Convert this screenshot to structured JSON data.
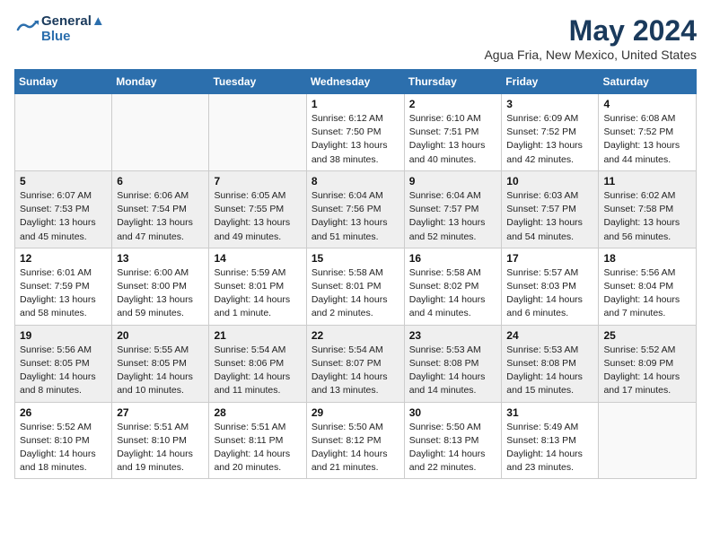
{
  "header": {
    "logo_line1": "General",
    "logo_line2": "Blue",
    "month": "May 2024",
    "location": "Agua Fria, New Mexico, United States"
  },
  "weekdays": [
    "Sunday",
    "Monday",
    "Tuesday",
    "Wednesday",
    "Thursday",
    "Friday",
    "Saturday"
  ],
  "weeks": [
    [
      {
        "day": "",
        "info": ""
      },
      {
        "day": "",
        "info": ""
      },
      {
        "day": "",
        "info": ""
      },
      {
        "day": "1",
        "info": "Sunrise: 6:12 AM\nSunset: 7:50 PM\nDaylight: 13 hours\nand 38 minutes."
      },
      {
        "day": "2",
        "info": "Sunrise: 6:10 AM\nSunset: 7:51 PM\nDaylight: 13 hours\nand 40 minutes."
      },
      {
        "day": "3",
        "info": "Sunrise: 6:09 AM\nSunset: 7:52 PM\nDaylight: 13 hours\nand 42 minutes."
      },
      {
        "day": "4",
        "info": "Sunrise: 6:08 AM\nSunset: 7:52 PM\nDaylight: 13 hours\nand 44 minutes."
      }
    ],
    [
      {
        "day": "5",
        "info": "Sunrise: 6:07 AM\nSunset: 7:53 PM\nDaylight: 13 hours\nand 45 minutes."
      },
      {
        "day": "6",
        "info": "Sunrise: 6:06 AM\nSunset: 7:54 PM\nDaylight: 13 hours\nand 47 minutes."
      },
      {
        "day": "7",
        "info": "Sunrise: 6:05 AM\nSunset: 7:55 PM\nDaylight: 13 hours\nand 49 minutes."
      },
      {
        "day": "8",
        "info": "Sunrise: 6:04 AM\nSunset: 7:56 PM\nDaylight: 13 hours\nand 51 minutes."
      },
      {
        "day": "9",
        "info": "Sunrise: 6:04 AM\nSunset: 7:57 PM\nDaylight: 13 hours\nand 52 minutes."
      },
      {
        "day": "10",
        "info": "Sunrise: 6:03 AM\nSunset: 7:57 PM\nDaylight: 13 hours\nand 54 minutes."
      },
      {
        "day": "11",
        "info": "Sunrise: 6:02 AM\nSunset: 7:58 PM\nDaylight: 13 hours\nand 56 minutes."
      }
    ],
    [
      {
        "day": "12",
        "info": "Sunrise: 6:01 AM\nSunset: 7:59 PM\nDaylight: 13 hours\nand 58 minutes."
      },
      {
        "day": "13",
        "info": "Sunrise: 6:00 AM\nSunset: 8:00 PM\nDaylight: 13 hours\nand 59 minutes."
      },
      {
        "day": "14",
        "info": "Sunrise: 5:59 AM\nSunset: 8:01 PM\nDaylight: 14 hours\nand 1 minute."
      },
      {
        "day": "15",
        "info": "Sunrise: 5:58 AM\nSunset: 8:01 PM\nDaylight: 14 hours\nand 2 minutes."
      },
      {
        "day": "16",
        "info": "Sunrise: 5:58 AM\nSunset: 8:02 PM\nDaylight: 14 hours\nand 4 minutes."
      },
      {
        "day": "17",
        "info": "Sunrise: 5:57 AM\nSunset: 8:03 PM\nDaylight: 14 hours\nand 6 minutes."
      },
      {
        "day": "18",
        "info": "Sunrise: 5:56 AM\nSunset: 8:04 PM\nDaylight: 14 hours\nand 7 minutes."
      }
    ],
    [
      {
        "day": "19",
        "info": "Sunrise: 5:56 AM\nSunset: 8:05 PM\nDaylight: 14 hours\nand 8 minutes."
      },
      {
        "day": "20",
        "info": "Sunrise: 5:55 AM\nSunset: 8:05 PM\nDaylight: 14 hours\nand 10 minutes."
      },
      {
        "day": "21",
        "info": "Sunrise: 5:54 AM\nSunset: 8:06 PM\nDaylight: 14 hours\nand 11 minutes."
      },
      {
        "day": "22",
        "info": "Sunrise: 5:54 AM\nSunset: 8:07 PM\nDaylight: 14 hours\nand 13 minutes."
      },
      {
        "day": "23",
        "info": "Sunrise: 5:53 AM\nSunset: 8:08 PM\nDaylight: 14 hours\nand 14 minutes."
      },
      {
        "day": "24",
        "info": "Sunrise: 5:53 AM\nSunset: 8:08 PM\nDaylight: 14 hours\nand 15 minutes."
      },
      {
        "day": "25",
        "info": "Sunrise: 5:52 AM\nSunset: 8:09 PM\nDaylight: 14 hours\nand 17 minutes."
      }
    ],
    [
      {
        "day": "26",
        "info": "Sunrise: 5:52 AM\nSunset: 8:10 PM\nDaylight: 14 hours\nand 18 minutes."
      },
      {
        "day": "27",
        "info": "Sunrise: 5:51 AM\nSunset: 8:10 PM\nDaylight: 14 hours\nand 19 minutes."
      },
      {
        "day": "28",
        "info": "Sunrise: 5:51 AM\nSunset: 8:11 PM\nDaylight: 14 hours\nand 20 minutes."
      },
      {
        "day": "29",
        "info": "Sunrise: 5:50 AM\nSunset: 8:12 PM\nDaylight: 14 hours\nand 21 minutes."
      },
      {
        "day": "30",
        "info": "Sunrise: 5:50 AM\nSunset: 8:13 PM\nDaylight: 14 hours\nand 22 minutes."
      },
      {
        "day": "31",
        "info": "Sunrise: 5:49 AM\nSunset: 8:13 PM\nDaylight: 14 hours\nand 23 minutes."
      },
      {
        "day": "",
        "info": ""
      }
    ]
  ]
}
